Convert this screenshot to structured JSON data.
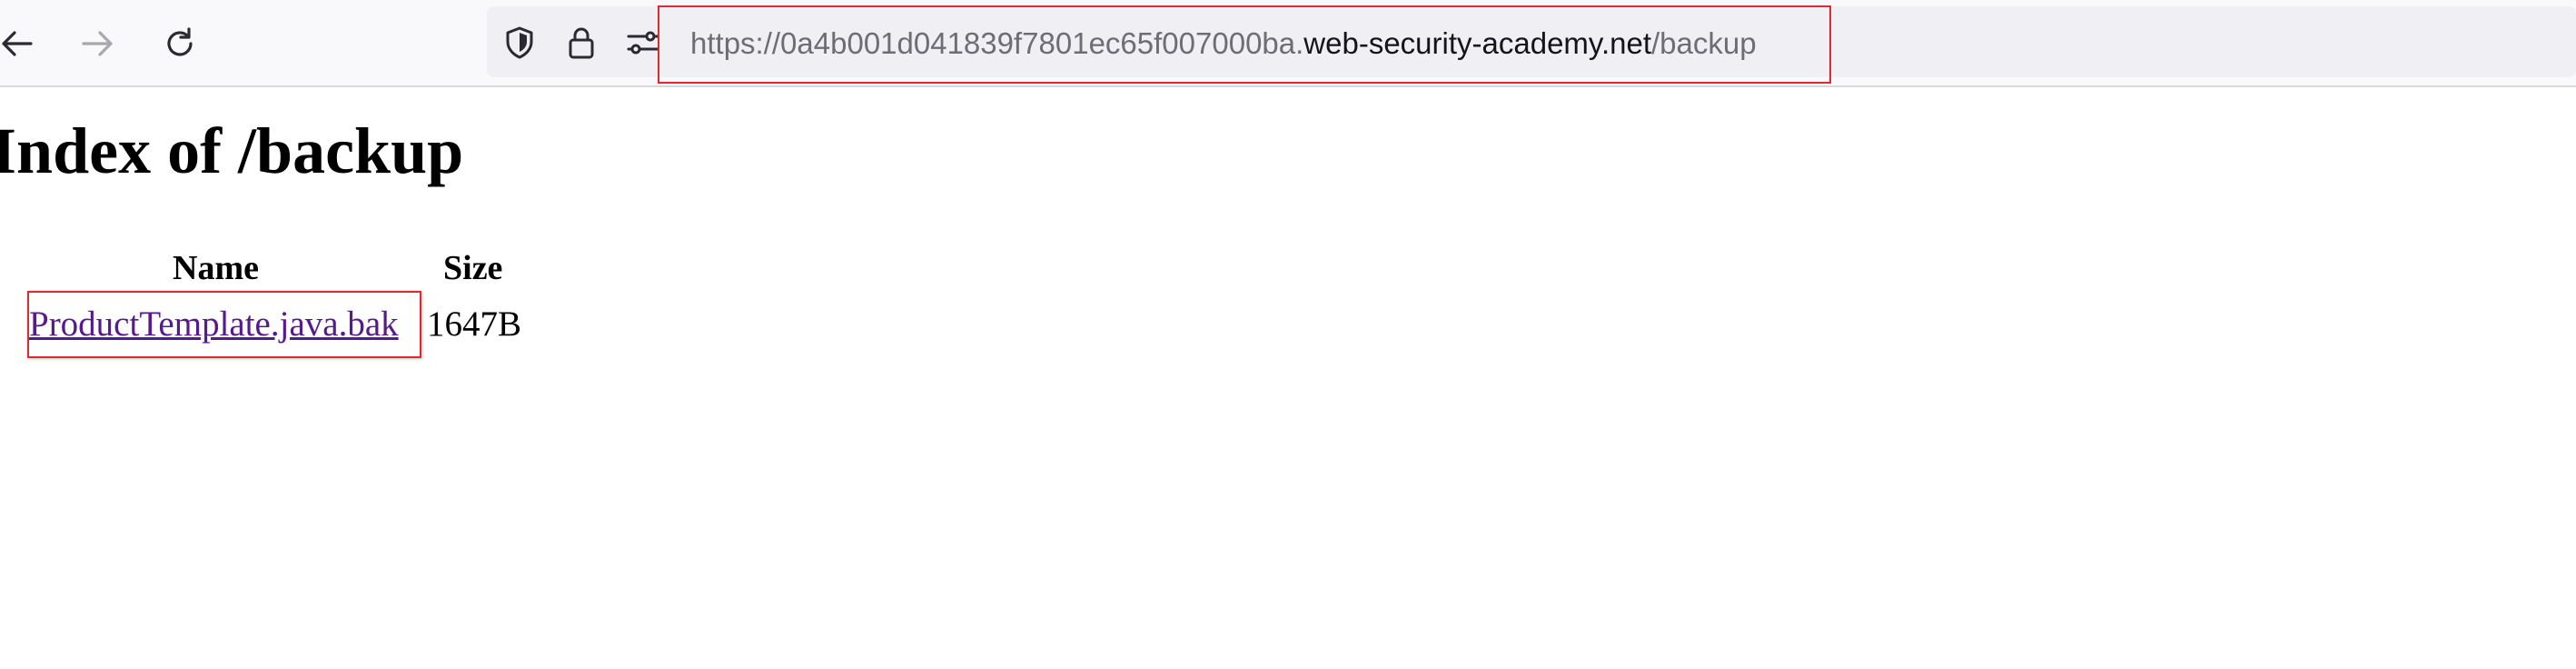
{
  "browser": {
    "url": {
      "scheme_and_subdomain": "https://0a4b001d041839f7801ec65f007000ba.",
      "domain": "web-security-academy.net",
      "path": "/backup"
    },
    "icons": {
      "back": "arrow-left-icon",
      "forward": "arrow-right-icon",
      "reload": "reload-icon",
      "shield": "shield-icon",
      "lock": "lock-icon",
      "permissions": "permissions-icon"
    },
    "highlight_color": "#e0282e"
  },
  "page": {
    "title": "Index of /backup",
    "table": {
      "headers": [
        "Name",
        "Size"
      ],
      "rows": [
        {
          "name": "ProductTemplate.java.bak",
          "size": "1647B"
        }
      ]
    },
    "link_color": "#551a8b"
  }
}
